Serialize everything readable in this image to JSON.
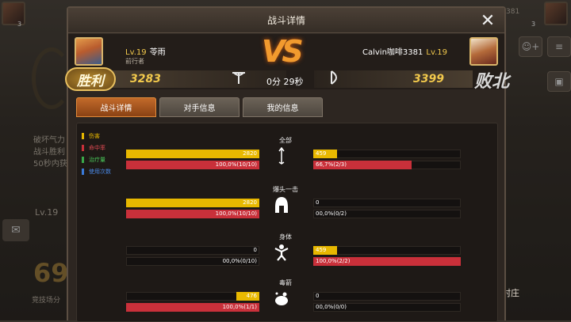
{
  "background": {
    "left_texts": [
      "破坏气力",
      "战斗胜利",
      "50秒内获"
    ],
    "level": "Lv.19",
    "big_number": "69",
    "bottom_label": "竞技场分",
    "right_label": "村庄",
    "top_left_badge": "3",
    "top_right_badge": "3",
    "top_right_fragment": "381"
  },
  "modal": {
    "title": "战斗详情",
    "close_icon": "close-icon"
  },
  "left_player": {
    "level": "Lv.19",
    "name": "苓雨",
    "subtitle": "前行者",
    "score": "3283",
    "result": "胜利"
  },
  "right_player": {
    "name": "Calvin咖啡3381",
    "level": "Lv.19",
    "score": "3399",
    "result": "败北"
  },
  "vs_label": "VS",
  "timer": "0分 29秒",
  "tabs": [
    {
      "label": "战斗详情",
      "active": true
    },
    {
      "label": "对手信息",
      "active": false
    },
    {
      "label": "我的信息",
      "active": false
    }
  ],
  "legend": [
    {
      "label": "伤害",
      "color": "#e8b800"
    },
    {
      "label": "命中率",
      "color": "#c9303a"
    },
    {
      "label": "治疗量",
      "color": "#3aa84a"
    },
    {
      "label": "使用次数",
      "color": "#3a7ad8"
    }
  ],
  "sections": [
    {
      "title": "全部",
      "icon": "arrow-icon",
      "left_damage": {
        "text": "2820",
        "fraction": 1.0
      },
      "left_hit": {
        "text": "100,0%(10/10)",
        "fraction": 1.0
      },
      "right_damage": {
        "text": "459",
        "fraction": 0.16
      },
      "right_hit": {
        "text": "66,7%(2/3)",
        "fraction": 0.667
      }
    },
    {
      "title": "爆头一击",
      "icon": "helmet-icon",
      "left_damage": {
        "text": "2820",
        "fraction": 1.0
      },
      "left_hit": {
        "text": "100,0%(10/10)",
        "fraction": 1.0
      },
      "right_damage": {
        "text": "0",
        "fraction": 0
      },
      "right_hit": {
        "text": "00,0%(0/2)",
        "fraction": 0
      }
    },
    {
      "title": "身体",
      "icon": "body-icon",
      "left_damage": {
        "text": "0",
        "fraction": 0
      },
      "left_hit": {
        "text": "00,0%(0/10)",
        "fraction": 0
      },
      "right_damage": {
        "text": "459",
        "fraction": 0.16
      },
      "right_hit": {
        "text": "100,0%(2/2)",
        "fraction": 1.0
      }
    },
    {
      "title": "毒箭",
      "icon": "poison-icon",
      "left_damage": {
        "text": "476",
        "fraction": 0.17
      },
      "left_hit": {
        "text": "100,0%(1/1)",
        "fraction": 1.0
      },
      "right_damage": {
        "text": "0",
        "fraction": 0
      },
      "right_hit": {
        "text": "00,0%(0/0)",
        "fraction": 0
      }
    }
  ]
}
